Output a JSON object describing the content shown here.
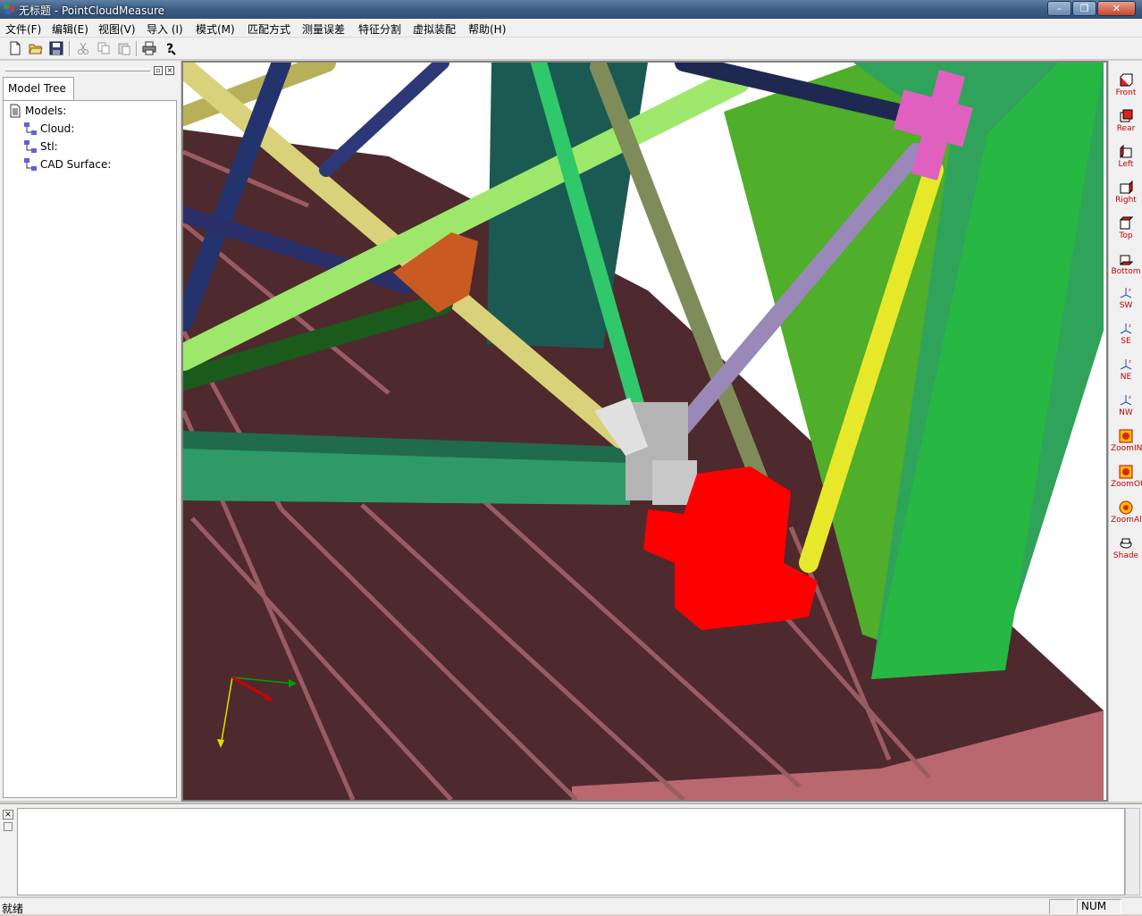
{
  "window": {
    "title": "无标题 - PointCloudMeasure",
    "minimize": "–",
    "maximize": "❐",
    "close": "✕"
  },
  "menu": [
    "文件(F)",
    "编辑(E)",
    "视图(V)",
    "导入 (I)",
    "模式(M)",
    "匹配方式",
    "测量误差",
    "特征分割",
    "虚拟装配",
    "帮助(H)"
  ],
  "toolbar": {
    "icons": [
      "new-file-icon",
      "open-folder-icon",
      "save-icon",
      "cut-icon",
      "copy-icon",
      "paste-icon",
      "print-icon",
      "help-icon"
    ]
  },
  "left_pane": {
    "tab": "Model Tree",
    "pin": "▫",
    "close": "×",
    "tree": {
      "root": "Models:",
      "children": [
        "Cloud:",
        "Stl:",
        "CAD Surface:"
      ]
    }
  },
  "view_toolbar": [
    {
      "label": "Front",
      "icon": "view-front-icon"
    },
    {
      "label": "Rear",
      "icon": "view-rear-icon"
    },
    {
      "label": "Left",
      "icon": "view-left-icon"
    },
    {
      "label": "Right",
      "icon": "view-right-icon"
    },
    {
      "label": "Top",
      "icon": "view-top-icon"
    },
    {
      "label": "Bottom",
      "icon": "view-bottom-icon"
    },
    {
      "label": "SW",
      "icon": "view-sw-axes-icon"
    },
    {
      "label": "SE",
      "icon": "view-se-axes-icon"
    },
    {
      "label": "NE",
      "icon": "view-ne-axes-icon"
    },
    {
      "label": "NW",
      "icon": "view-nw-axes-icon"
    },
    {
      "label": "ZoomIN",
      "icon": "zoom-in-icon"
    },
    {
      "label": "ZoomOUT",
      "icon": "zoom-out-icon"
    },
    {
      "label": "ZoomAll",
      "icon": "zoom-all-icon"
    },
    {
      "label": "Shade",
      "icon": "shade-icon"
    }
  ],
  "output_pane": {
    "close": "×",
    "text": ""
  },
  "status": {
    "text": "就绪",
    "num": "NUM"
  },
  "colors": {
    "floor": "#4e2a2e",
    "floor_lines": "#9a5c62",
    "floor_edge": "#b96870",
    "green_slab": "#2fa35a",
    "teal_strip": "#2e9a68",
    "tube_yellow": "#d9d27a",
    "tube_lime": "#9de86a",
    "tube_navy": "#23336e",
    "tube_olive": "#7f8c5a",
    "tube_lavender": "#9a88b8",
    "tube_pink": "#e060c0",
    "tube_yellow_bright": "#e8e82a",
    "selection_red": "#ff0000"
  }
}
